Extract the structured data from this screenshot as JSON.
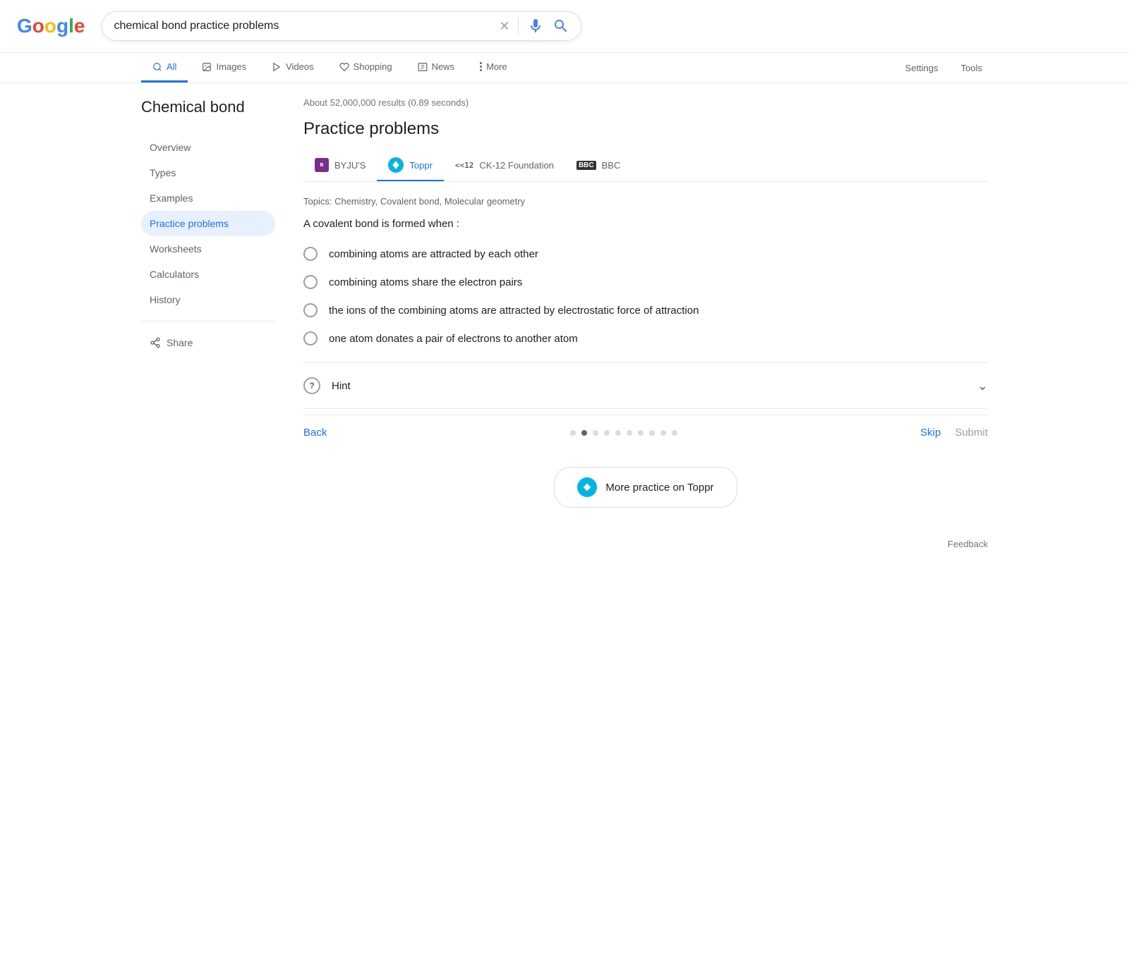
{
  "logo": {
    "g": "G",
    "o1": "o",
    "o2": "o",
    "g2": "g",
    "l": "l",
    "e": "e"
  },
  "search": {
    "query": "chemical bond practice problems",
    "placeholder": "Search"
  },
  "nav": {
    "tabs": [
      {
        "id": "all",
        "label": "All",
        "active": true
      },
      {
        "id": "images",
        "label": "Images",
        "active": false
      },
      {
        "id": "videos",
        "label": "Videos",
        "active": false
      },
      {
        "id": "shopping",
        "label": "Shopping",
        "active": false
      },
      {
        "id": "news",
        "label": "News",
        "active": false
      },
      {
        "id": "more",
        "label": "More",
        "active": false
      }
    ],
    "settings": "Settings",
    "tools": "Tools"
  },
  "results": {
    "count": "About 52,000,000 results (0.89 seconds)"
  },
  "sidebar": {
    "title": "Chemical bond",
    "items": [
      {
        "id": "overview",
        "label": "Overview",
        "active": false
      },
      {
        "id": "types",
        "label": "Types",
        "active": false
      },
      {
        "id": "examples",
        "label": "Examples",
        "active": false
      },
      {
        "id": "practice-problems",
        "label": "Practice problems",
        "active": true
      },
      {
        "id": "worksheets",
        "label": "Worksheets",
        "active": false
      },
      {
        "id": "calculators",
        "label": "Calculators",
        "active": false
      },
      {
        "id": "history",
        "label": "History",
        "active": false
      }
    ],
    "share": "Share"
  },
  "content": {
    "section_title": "Practice problems",
    "source_tabs": [
      {
        "id": "byjus",
        "label": "BYJU'S",
        "active": false
      },
      {
        "id": "toppr",
        "label": "Toppr",
        "active": true
      },
      {
        "id": "ck12",
        "label": "CK-12 Foundation",
        "active": false
      },
      {
        "id": "bbc",
        "label": "BBC",
        "active": false
      }
    ],
    "topics": "Topics: Chemistry, Covalent bond, Molecular geometry",
    "question": "A covalent bond is formed when :",
    "options": [
      {
        "id": "a",
        "text": "combining atoms are attracted by each other"
      },
      {
        "id": "b",
        "text": "combining atoms share the electron pairs"
      },
      {
        "id": "c",
        "text": "the ions of the combining atoms are attracted by electrostatic force of attraction"
      },
      {
        "id": "d",
        "text": "one atom donates a pair of electrons to another atom"
      }
    ],
    "hint_label": "Hint",
    "nav": {
      "back": "Back",
      "skip": "Skip",
      "submit": "Submit",
      "dots_count": 10,
      "active_dot": 1
    },
    "more_practice": "More practice on Toppr",
    "feedback": "Feedback"
  }
}
